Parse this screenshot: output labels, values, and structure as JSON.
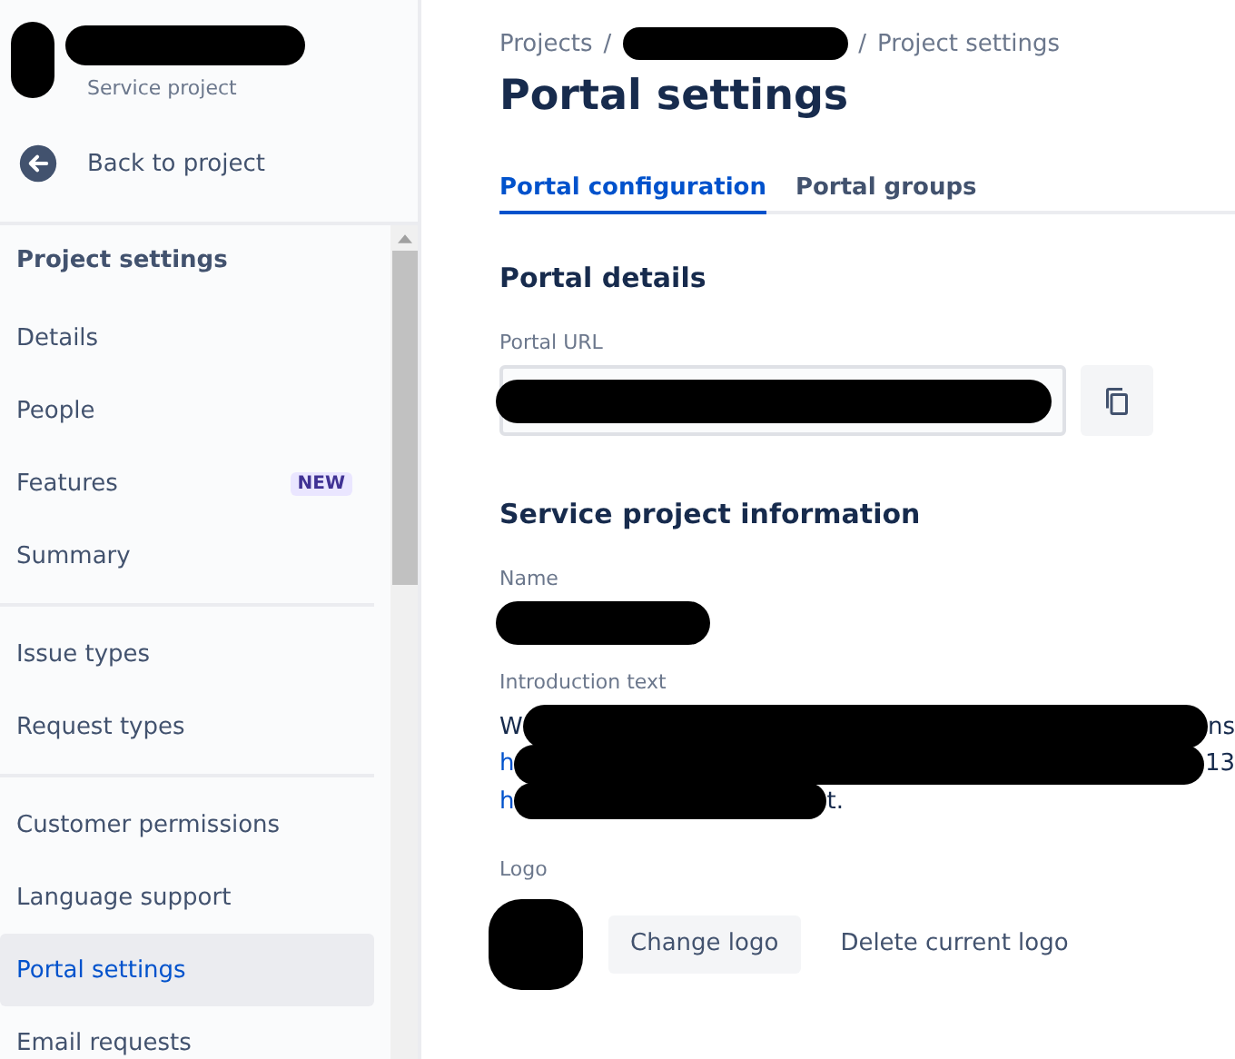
{
  "project": {
    "type": "Service project"
  },
  "back_link": "Back to project",
  "sidebar": {
    "sections": [
      {
        "items": [
          {
            "label": "Project settings",
            "kind": "heading"
          },
          {
            "label": "Details",
            "kind": "link",
            "selected": false
          },
          {
            "label": "People",
            "kind": "link",
            "selected": false
          },
          {
            "label": "Features",
            "kind": "link",
            "selected": false,
            "badge": "NEW"
          },
          {
            "label": "Summary",
            "kind": "link",
            "selected": false
          }
        ]
      },
      {
        "items": [
          {
            "label": "Issue types",
            "kind": "link",
            "selected": false
          },
          {
            "label": "Request types",
            "kind": "link",
            "selected": false
          }
        ]
      },
      {
        "items": [
          {
            "label": "Customer permissions",
            "kind": "link",
            "selected": false
          },
          {
            "label": "Language support",
            "kind": "link",
            "selected": false
          },
          {
            "label": "Portal settings",
            "kind": "link",
            "selected": true
          },
          {
            "label": "Email requests",
            "kind": "link",
            "selected": false
          }
        ]
      }
    ]
  },
  "breadcrumbs": [
    "Projects",
    "Project settings"
  ],
  "breadcrumb_separators": [
    "/",
    "/"
  ],
  "title": "Portal settings",
  "tabs": [
    {
      "label": "Portal configuration",
      "selected": true
    },
    {
      "label": "Portal groups",
      "selected": false
    }
  ],
  "portal_details": {
    "heading": "Portal details",
    "url_label": "Portal URL"
  },
  "info": {
    "heading": "Service project information",
    "name_label": "Name",
    "intro_label": "Introduction text",
    "intro_lines": [
      {
        "start": "W",
        "end": "ns"
      },
      {
        "start": "h",
        "end": "13"
      },
      {
        "start": "h",
        "end": "t."
      }
    ],
    "logo_label": "Logo",
    "buttons": [
      "Change logo",
      "Delete current logo"
    ]
  }
}
